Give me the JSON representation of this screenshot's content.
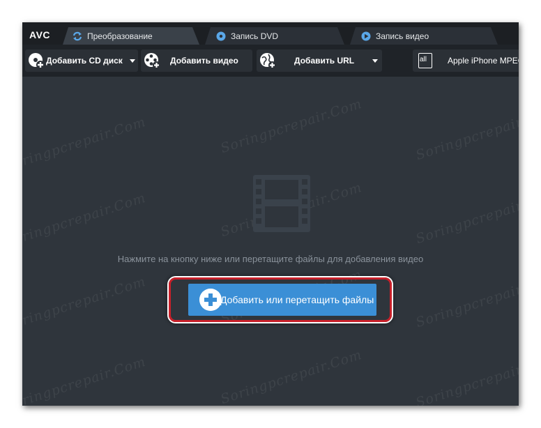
{
  "app": {
    "logo": "AVC"
  },
  "tabs": [
    {
      "label": "Преобразование",
      "icon": "convert-refresh-icon",
      "active": true
    },
    {
      "label": "Запись DVD",
      "icon": "dvd-disc-icon",
      "active": false
    },
    {
      "label": "Запись видео",
      "icon": "play-record-icon",
      "active": false
    }
  ],
  "toolbar": {
    "add_cd": {
      "label": "Добавить CD диск",
      "icon": "cd-add-icon"
    },
    "add_video": {
      "label": "Добавить видео",
      "icon": "film-reel-add-icon"
    },
    "add_url": {
      "label": "Добавить URL",
      "icon": "globe-add-icon"
    },
    "profile": {
      "label": "Apple iPhone MPEG",
      "icon": "profile-all-icon",
      "icon_text": "all"
    }
  },
  "main": {
    "hint": "Нажмите на кнопку ниже или перетащите файлы для добавления видео",
    "add_button_label": "Добавить или перетащить файлы",
    "add_button_color": "#3b8fd6",
    "highlight_color": "#c8202a"
  },
  "watermark": {
    "text": "Soringpcrepair.Com"
  }
}
